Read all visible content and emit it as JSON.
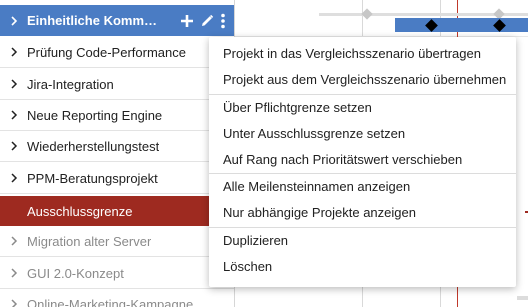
{
  "project_list": {
    "header": {
      "label": "Einheitliche Kommunik…",
      "add_icon": "plus-icon",
      "edit_icon": "pencil-icon",
      "more_icon": "more-vertical-icon"
    },
    "rows": [
      {
        "label": "Prüfung Code-Performance"
      },
      {
        "label": "Jira-Integration"
      },
      {
        "label": "Neue Reporting Engine"
      },
      {
        "label": "Wiederherstellungstest"
      },
      {
        "label": "PPM-Beratungsprojekt"
      }
    ],
    "threshold_row": {
      "label": "Ausschlussgrenze"
    },
    "excluded_rows": [
      {
        "label": "Migration alter Server"
      },
      {
        "label": "GUI 2.0-Konzept"
      },
      {
        "label": "Online-Marketing-Kampagne"
      }
    ]
  },
  "context_menu": {
    "groups": [
      [
        "Projekt in das Vergleichsszenario übertragen",
        "Projekt aus dem Vergleichsszenario übernehmen"
      ],
      [
        "Über Pflichtgrenze setzen",
        "Unter Ausschlussgrenze setzen",
        "Auf Rang nach Prioritätswert verschieben"
      ],
      [
        "Alle Meilensteinnamen anzeigen",
        "Nur abhängige Projekte anzeigen"
      ],
      [
        "Duplizieren",
        "Löschen"
      ]
    ]
  },
  "colors": {
    "header_bg": "#4a7cc4",
    "threshold_bg": "#9e2a20",
    "gantt_bar": "#4a7cc4",
    "milestone": "#000000",
    "today_line": "#c0392b"
  }
}
